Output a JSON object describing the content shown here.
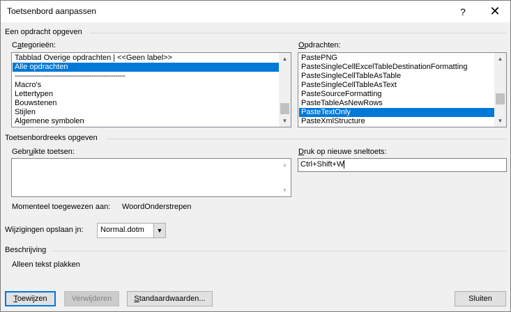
{
  "window": {
    "title": "Toetsenbord aanpassen",
    "help_glyph": "?",
    "close_glyph": "✕"
  },
  "section_command": {
    "title": "Een opdracht opgeven",
    "categories_label_pre": "C",
    "categories_label_u": "a",
    "categories_label_post": "tegorieën:",
    "commands_label_pre": "",
    "commands_label_u": "O",
    "commands_label_post": "pdrachten:",
    "categories": [
      {
        "label": "Tabblad Overige opdrachten | <<Geen label>>",
        "selected": false
      },
      {
        "label": "Alle opdrachten",
        "selected": true
      },
      {
        "label": "--------------------------------------------------------",
        "selected": false,
        "divider": true
      },
      {
        "label": "Macro's",
        "selected": false
      },
      {
        "label": "Lettertypen",
        "selected": false
      },
      {
        "label": "Bouwstenen",
        "selected": false
      },
      {
        "label": "Stijlen",
        "selected": false
      },
      {
        "label": "Algemene symbolen",
        "selected": false
      }
    ],
    "commands": [
      {
        "label": "PastePNG",
        "selected": false
      },
      {
        "label": "PasteSingleCellExcelTableDestinationFormatting",
        "selected": false
      },
      {
        "label": "PasteSingleCellTableAsTable",
        "selected": false
      },
      {
        "label": "PasteSingleCellTableAsText",
        "selected": false
      },
      {
        "label": "PasteSourceFormatting",
        "selected": false
      },
      {
        "label": "PasteTableAsNewRows",
        "selected": false
      },
      {
        "label": "PasteTextOnly",
        "selected": true
      },
      {
        "label": "PasteXmlStructure",
        "selected": false
      }
    ]
  },
  "section_keys": {
    "title": "Toetsenbordreeks opgeven",
    "current_keys_label_pre": "Gebr",
    "current_keys_label_u": "u",
    "current_keys_label_post": "ikte toetsen:",
    "new_shortcut_label_pre": "",
    "new_shortcut_label_u": "D",
    "new_shortcut_label_post": "ruk op nieuwe sneltoets:",
    "new_shortcut_value": "Ctrl+Shift+W",
    "assigned_label": "Momenteel toegewezen aan:",
    "assigned_value": "WoordOnderstrepen",
    "save_in_label_pre": "Wijzigingen opslaan ",
    "save_in_label_u": "i",
    "save_in_label_post": "n:",
    "save_in_value": "Normal.dotm"
  },
  "section_description": {
    "title": "Beschrijving",
    "text": "Alleen tekst plakken"
  },
  "buttons": {
    "assign_u": "T",
    "assign_post": "oewijzen",
    "remove": "Verwijderen",
    "defaults_u": "S",
    "defaults_post": "tandaardwaarden...",
    "close": "Sluiten"
  },
  "colors": {
    "selection": "#0078d7",
    "dialog_bg": "#f0f0f0",
    "title_bg": "#ffffff"
  }
}
